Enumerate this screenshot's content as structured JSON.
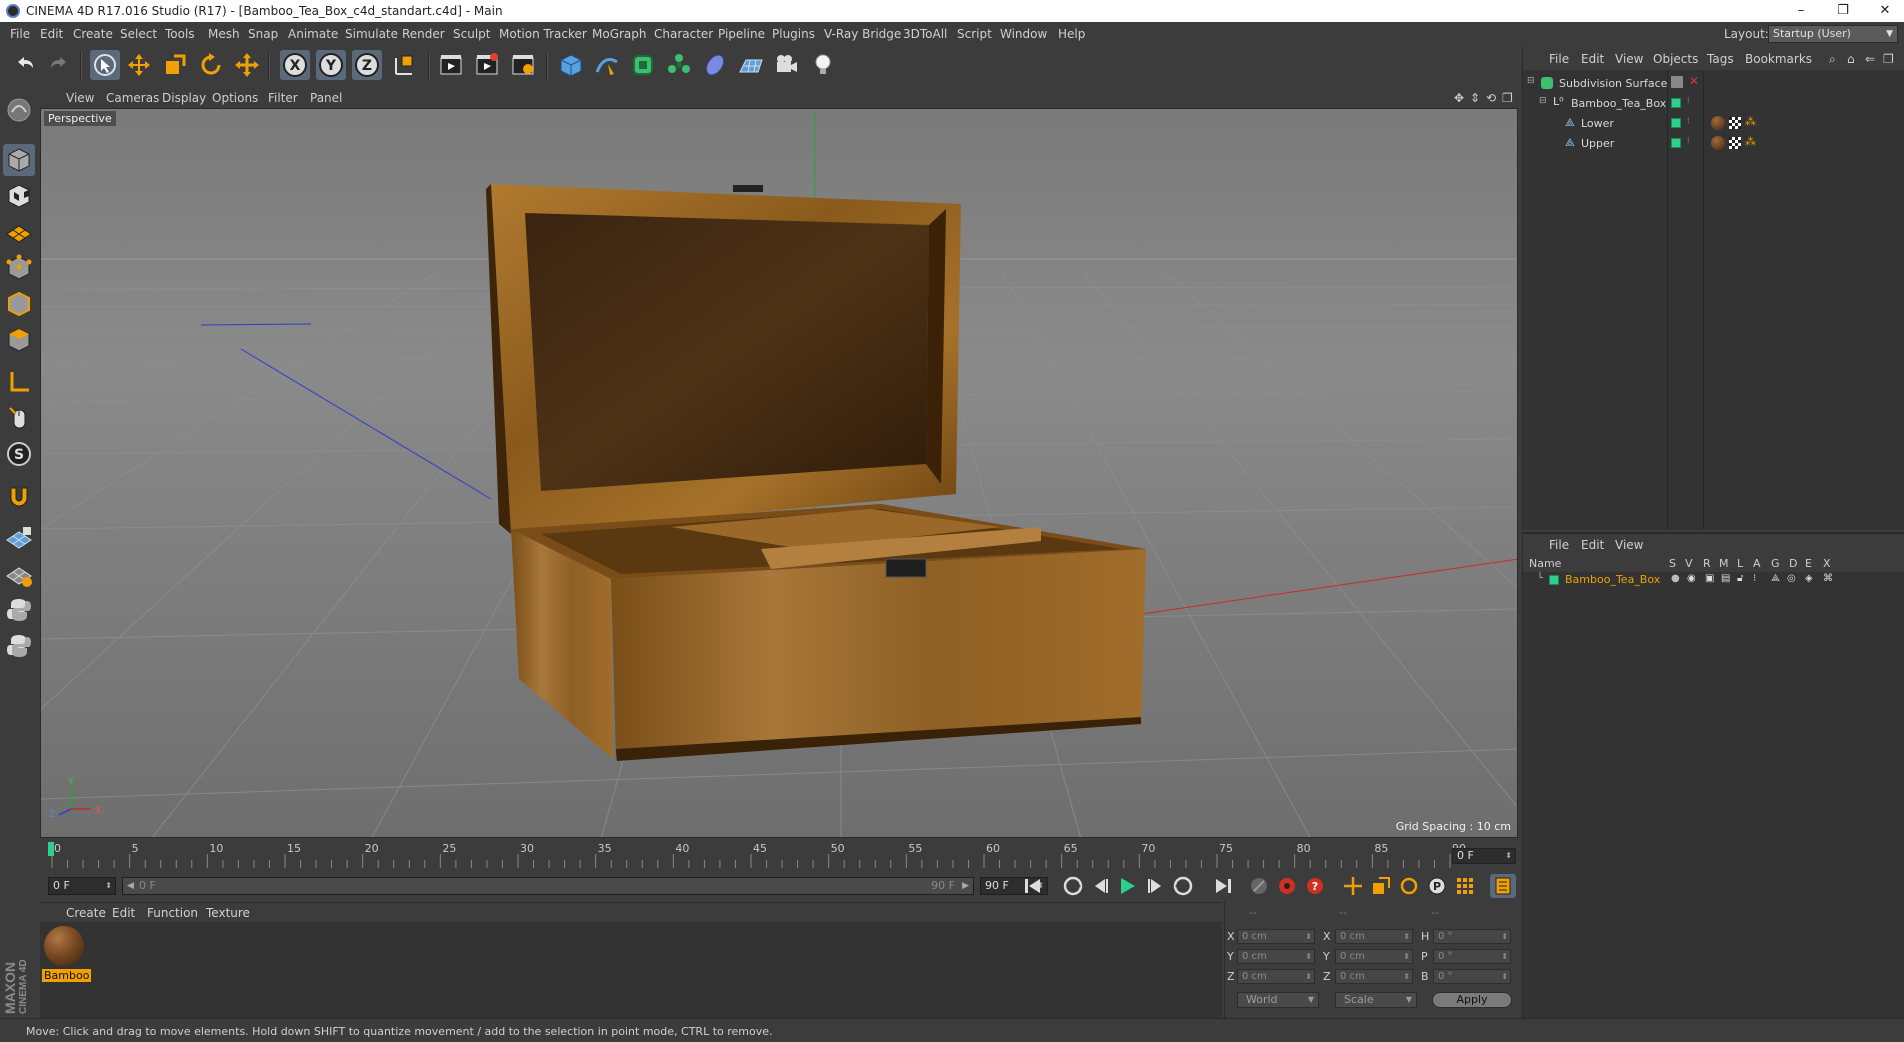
{
  "window": {
    "title": "CINEMA 4D R17.016 Studio (R17) - [Bamboo_Tea_Box_c4d_standart.c4d] - Main",
    "controls": [
      "–",
      "❐",
      "✕"
    ]
  },
  "menubar": {
    "items": [
      "File",
      "Edit",
      "Create",
      "Select",
      "Tools",
      "Mesh",
      "Snap",
      "Animate",
      "Simulate",
      "Render",
      "Sculpt",
      "Motion Tracker",
      "MoGraph",
      "Character",
      "Pipeline",
      "Plugins",
      "V-Ray Bridge",
      "3DToAll",
      "Script",
      "Window",
      "Help"
    ],
    "layout_label": "Layout:",
    "layout_value": "Startup (User)"
  },
  "toolbar": {
    "buttons": [
      "undo-icon",
      "redo-icon",
      "select-icon",
      "move-icon",
      "scale-icon",
      "rotate-icon",
      "move-alt-icon",
      "x-axis-icon",
      "y-axis-icon",
      "z-axis-icon",
      "world-coords-icon",
      "render-view-icon",
      "render-picture-queue-icon",
      "render-settings-icon",
      "cube-icon",
      "pen-spline-icon",
      "subdivision-icon",
      "mograph-cloner-icon",
      "deformer-icon",
      "floor-icon",
      "camera-icon",
      "light-icon"
    ]
  },
  "viewport": {
    "menu": [
      "View",
      "Cameras",
      "Display",
      "Options",
      "Filter",
      "Panel"
    ],
    "label": "Perspective",
    "grid_spacing": "Grid Spacing : 10 cm",
    "axis_labels": [
      "Y",
      "Z",
      "X"
    ]
  },
  "timeline": {
    "ticks": [
      "0",
      "5",
      "10",
      "15",
      "20",
      "25",
      "30",
      "35",
      "40",
      "45",
      "50",
      "55",
      "60",
      "65",
      "70",
      "75",
      "80",
      "85",
      "90"
    ],
    "current_frame": "0 F",
    "start_field": "0 F",
    "range_start": "0 F",
    "range_end": "90 F",
    "end_field": "90 F"
  },
  "material_manager": {
    "menu": [
      "Create",
      "Edit",
      "Function",
      "Texture"
    ],
    "material_name": "Bamboo"
  },
  "coordinates": {
    "headers": [
      "--",
      "--",
      "--"
    ],
    "rows": [
      {
        "axis": "X",
        "pos": "0 cm",
        "axis2": "X",
        "size": "0 cm",
        "rot_label": "H",
        "rot": "0 °"
      },
      {
        "axis": "Y",
        "pos": "0 cm",
        "axis2": "Y",
        "size": "0 cm",
        "rot_label": "P",
        "rot": "0 °"
      },
      {
        "axis": "Z",
        "pos": "0 cm",
        "axis2": "Z",
        "size": "0 cm",
        "rot_label": "B",
        "rot": "0 °"
      }
    ],
    "mode": "World",
    "size_mode": "Scale",
    "apply": "Apply"
  },
  "object_manager": {
    "menu": [
      "File",
      "Edit",
      "View",
      "Objects",
      "Tags",
      "Bookmarks"
    ],
    "objects": [
      {
        "name": "Subdivision Surface",
        "indent": 0
      },
      {
        "name": "Bamboo_Tea_Box",
        "indent": 1
      },
      {
        "name": "Lower",
        "indent": 2
      },
      {
        "name": "Upper",
        "indent": 2
      }
    ]
  },
  "attribute_manager": {
    "menu": [
      "File",
      "Edit",
      "View"
    ],
    "columns": [
      "Name",
      "S",
      "V",
      "R",
      "M",
      "L",
      "A",
      "G",
      "D",
      "E",
      "X"
    ],
    "layer_name": "Bamboo_Tea_Box"
  },
  "status": {
    "text": "Move: Click and drag to move elements. Hold down SHIFT to quantize movement / add to the selection in point mode, CTRL to remove."
  },
  "branding": {
    "maxon": "MAXON",
    "cinema": "CINEMA 4D"
  },
  "colors": {
    "accent_orange": "#f0a000",
    "layer_green": "#2ecf8b",
    "panel_bg": "#3c3c3c"
  }
}
